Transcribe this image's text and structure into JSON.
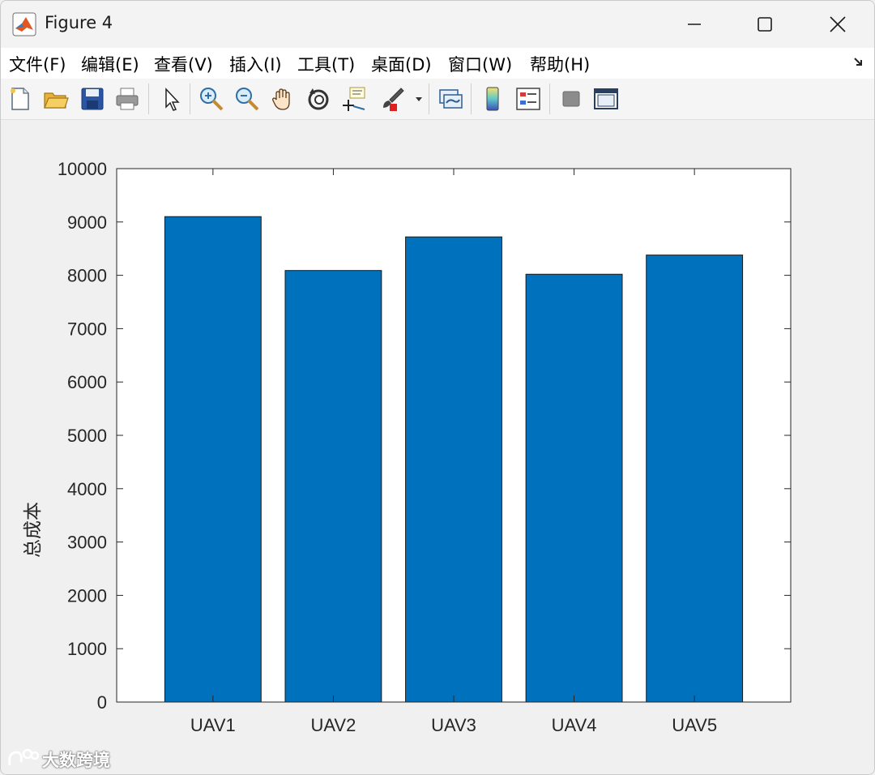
{
  "window": {
    "title": "Figure 4"
  },
  "menu": {
    "items": [
      "文件(F)",
      "编辑(E)",
      "查看(V)",
      "插入(I)",
      "工具(T)",
      "桌面(D)",
      "窗口(W)",
      "帮助(H)"
    ]
  },
  "toolbar": {
    "icons": [
      "new-figure-icon",
      "open-file-icon",
      "save-icon",
      "print-icon",
      "select-arrow-icon",
      "zoom-in-icon",
      "zoom-out-icon",
      "pan-hand-icon",
      "rotate-3d-icon",
      "data-cursor-icon",
      "brush-icon",
      "brush-dropdown-icon",
      "link-plot-icon",
      "colorbar-icon",
      "legend-icon",
      "hide-plot-tools-icon",
      "show-plot-tools-icon"
    ]
  },
  "colors": {
    "bar_fill": "#0072bd",
    "axes_background": "#ffffff",
    "figure_background": "#f0f0f0"
  },
  "chart_data": {
    "type": "bar",
    "categories": [
      "UAV1",
      "UAV2",
      "UAV3",
      "UAV4",
      "UAV5"
    ],
    "values": [
      9100,
      8090,
      8720,
      8020,
      8380
    ],
    "title": "",
    "xlabel": "",
    "ylabel": "总成本",
    "ylim": [
      0,
      10000
    ],
    "yticks": [
      0,
      1000,
      2000,
      3000,
      4000,
      5000,
      6000,
      7000,
      8000,
      9000,
      10000
    ],
    "ytick_labels": [
      "0",
      "1000",
      "2000",
      "3000",
      "4000",
      "5000",
      "6000",
      "7000",
      "8000",
      "9000",
      "10000"
    ],
    "grid": false,
    "legend": "none"
  },
  "watermark": {
    "text": "大数跨境"
  }
}
